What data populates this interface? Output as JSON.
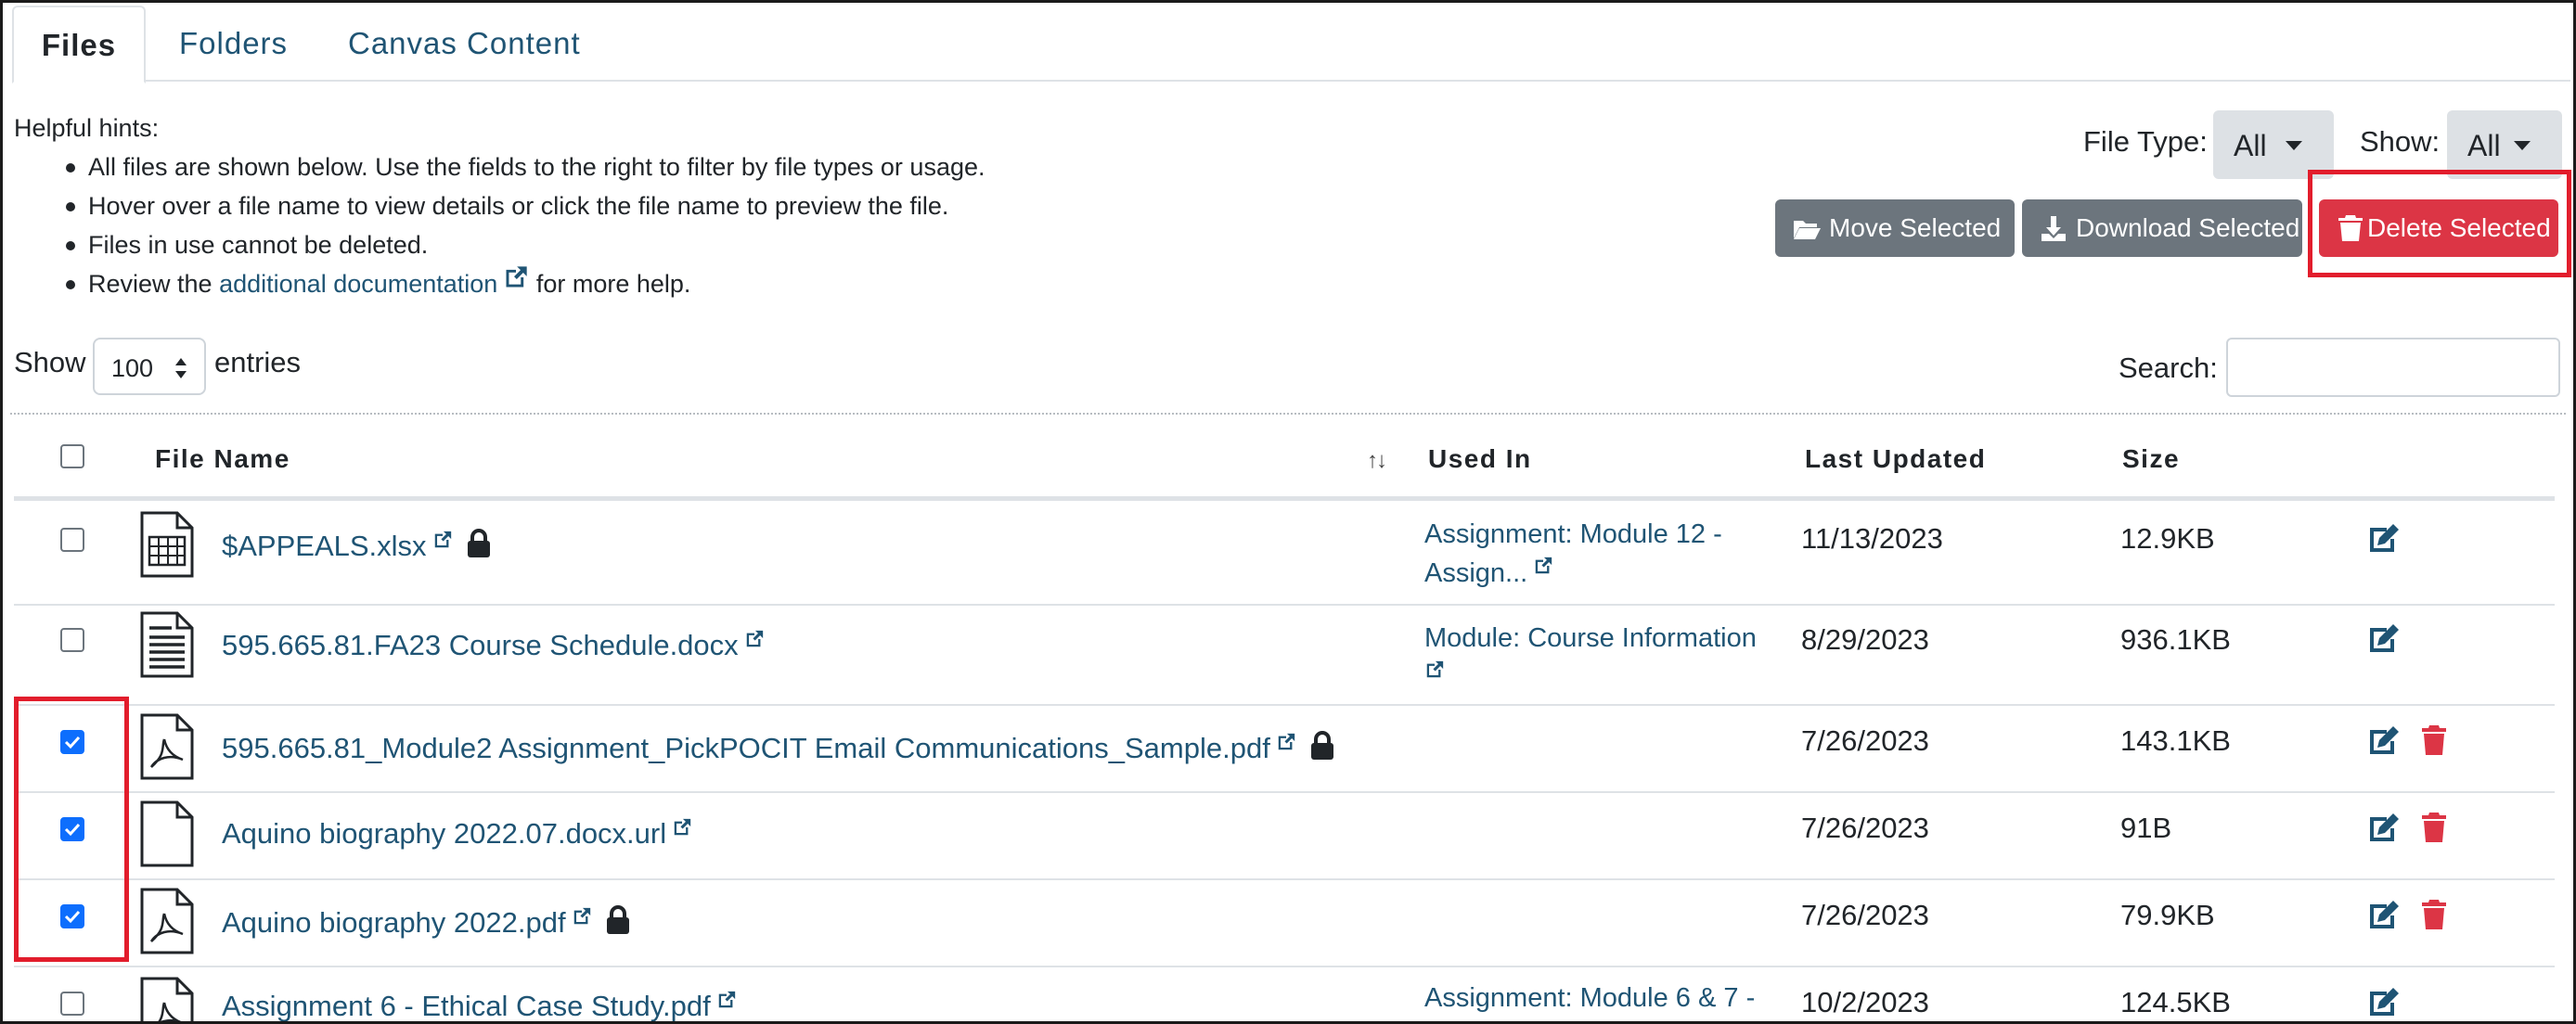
{
  "tabs": [
    {
      "label": "Files"
    },
    {
      "label": "Folders"
    },
    {
      "label": "Canvas Content"
    }
  ],
  "hints": {
    "title": "Helpful hints:",
    "items": [
      "All files are shown below. Use the fields to the right to filter by file types or usage.",
      "Hover over a file name to view details or click the file name to preview the file.",
      "Files in use cannot be deleted."
    ],
    "last_prefix": "Review the",
    "last_link": "additional documentation",
    "last_suffix": "for more help."
  },
  "filters": {
    "file_type_label": "File Type:",
    "file_type_value": "All",
    "show_label": "Show:",
    "show_value": "All"
  },
  "actions": {
    "move": "Move Selected",
    "download": "Download Selected",
    "delete": "Delete Selected"
  },
  "length": {
    "show": "Show",
    "value": "100",
    "entries": "entries"
  },
  "search": {
    "label": "Search:",
    "value": ""
  },
  "table": {
    "headers": {
      "file_name": "File Name",
      "used_in": "Used In",
      "last_updated": "Last Updated",
      "size": "Size"
    },
    "rows": [
      {
        "name": "$APPEALS.xlsx",
        "icon": "spreadsheet-file-icon",
        "locked": true,
        "used_in_1": "Assignment: Module 12 -",
        "used_in_2": "Assign...",
        "date": "11/13/2023",
        "size": "12.9KB",
        "checked": false,
        "deletable": false
      },
      {
        "name": "595.665.81.FA23 Course Schedule.docx",
        "icon": "document-file-icon",
        "locked": false,
        "used_in_1": "Module: Course Information",
        "used_in_2": "",
        "date": "8/29/2023",
        "size": "936.1KB",
        "checked": false,
        "deletable": false
      },
      {
        "name": "595.665.81_Module2 Assignment_PickPOCIT Email Communications_Sample.pdf",
        "icon": "pdf-file-icon",
        "locked": true,
        "used_in_1": "",
        "used_in_2": "",
        "date": "7/26/2023",
        "size": "143.1KB",
        "checked": true,
        "deletable": true
      },
      {
        "name": "Aquino biography 2022.07.docx.url",
        "icon": "blank-file-icon",
        "locked": false,
        "used_in_1": "",
        "used_in_2": "",
        "date": "7/26/2023",
        "size": "91B",
        "checked": true,
        "deletable": true
      },
      {
        "name": "Aquino biography 2022.pdf",
        "icon": "pdf-file-icon",
        "locked": true,
        "used_in_1": "",
        "used_in_2": "",
        "date": "7/26/2023",
        "size": "79.9KB",
        "checked": true,
        "deletable": true
      },
      {
        "name": "Assignment 6 - Ethical Case Study.pdf",
        "icon": "pdf-file-icon",
        "locked": false,
        "used_in_1": "Assignment: Module 6 & 7 -",
        "used_in_2": "",
        "date": "10/2/2023",
        "size": "124.5KB",
        "checked": false,
        "deletable": false
      }
    ]
  },
  "colors": {
    "link": "#1f5474",
    "delete": "#dc3545",
    "secondary": "#6c757d",
    "checkbox": "#0d6efd",
    "highlight": "#e21d2c"
  }
}
